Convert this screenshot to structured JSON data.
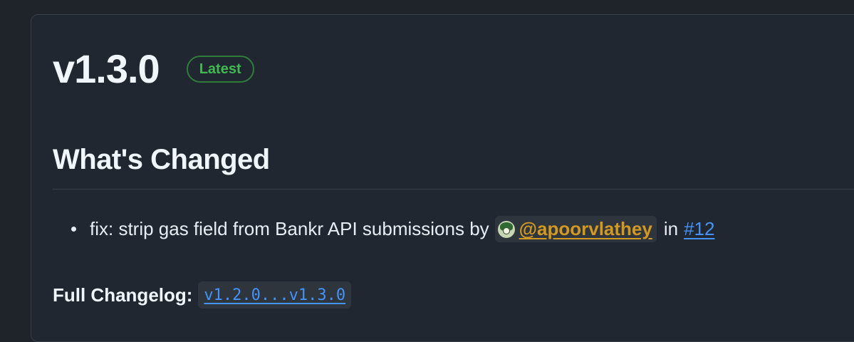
{
  "release": {
    "title": "v1.3.0",
    "badge": "Latest"
  },
  "section": {
    "heading": "What's Changed"
  },
  "changes": [
    {
      "text_before": "fix: strip gas field from Bankr API submissions by",
      "author": "@apoorvlathey",
      "text_in": "in",
      "pr": "#12"
    }
  ],
  "changelog": {
    "label": "Full Changelog:",
    "compare": "v1.2.0...v1.3.0"
  },
  "colors": {
    "background": "#1f232a",
    "card": "#212730",
    "badge_green": "#3fb950",
    "author_gold": "#d29922",
    "link_blue": "#4493f8"
  }
}
